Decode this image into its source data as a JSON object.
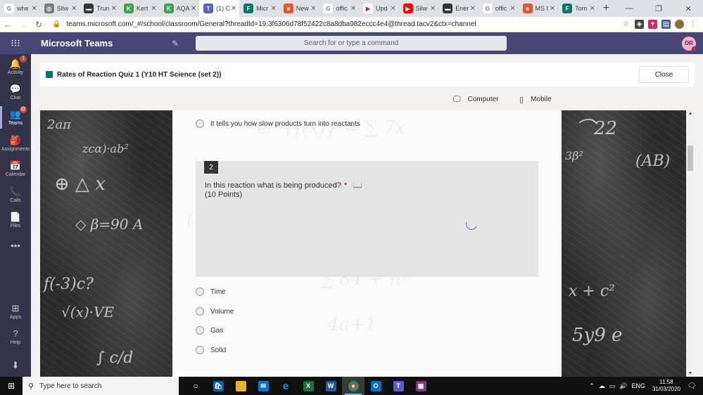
{
  "browser": {
    "tabs": [
      {
        "title": "whe",
        "favicon_letter": "G",
        "color": "#ffffff",
        "fg": "#4285f4",
        "active": false
      },
      {
        "title": "Silw",
        "favicon_letter": "◎",
        "color": "#7a7a7a",
        "fg": "#ffffff",
        "active": false
      },
      {
        "title": "Trun",
        "favicon_letter": "▬",
        "color": "#333333",
        "fg": "#ffffff",
        "active": false
      },
      {
        "title": "Kert",
        "favicon_letter": "K",
        "color": "#3aa655",
        "fg": "#ffffff",
        "active": false
      },
      {
        "title": "AQA",
        "favicon_letter": "K",
        "color": "#3aa655",
        "fg": "#ffffff",
        "active": false
      },
      {
        "title": "(1) C",
        "favicon_letter": "T",
        "color": "#5b5fc7",
        "fg": "#ffffff",
        "active": true
      },
      {
        "title": "Micr",
        "favicon_letter": "F",
        "color": "#077568",
        "fg": "#ffffff",
        "active": false
      },
      {
        "title": "New",
        "favicon_letter": "■",
        "color": "#f25022",
        "fg": "#ffffff",
        "active": false
      },
      {
        "title": "offic",
        "favicon_letter": "G",
        "color": "#ffffff",
        "fg": "#4285f4",
        "active": false
      },
      {
        "title": "Upd",
        "favicon_letter": "▶",
        "color": "#ffffff",
        "fg": "#c2185b",
        "active": false
      },
      {
        "title": "Silw",
        "favicon_letter": "▶",
        "color": "#ff0000",
        "fg": "#ffffff",
        "active": false
      },
      {
        "title": "Ener",
        "favicon_letter": "▬",
        "color": "#333333",
        "fg": "#ffffff",
        "active": false
      },
      {
        "title": "offic",
        "favicon_letter": "G",
        "color": "#ffffff",
        "fg": "#4285f4",
        "active": false
      },
      {
        "title": "MS I",
        "favicon_letter": "■",
        "color": "#f25022",
        "fg": "#ffffff",
        "active": false
      },
      {
        "title": "Tom",
        "favicon_letter": "F",
        "color": "#077568",
        "fg": "#ffffff",
        "active": false
      }
    ],
    "tab_close": "✕",
    "new_tab": "+",
    "url": "teams.microsoft.com/_#/school/classroom/General?threadId=19:3f6306d78f52422c8a8dba982eccc4e4@thread.tacv2&ctx=channel"
  },
  "teams": {
    "app_name": "Microsoft Teams",
    "search_placeholder": "Search for or type a command",
    "avatar_initials": "DR",
    "rail": [
      {
        "label": "Activity",
        "icon": "bell-icon",
        "glyph": "🔔",
        "badge": "1"
      },
      {
        "label": "Chat",
        "icon": "chat-icon",
        "glyph": "💬",
        "badge": ""
      },
      {
        "label": "Teams",
        "icon": "teams-icon",
        "glyph": "👥",
        "badge": "@"
      },
      {
        "label": "Assignments",
        "icon": "assignments-icon",
        "glyph": "🎒",
        "badge": ""
      },
      {
        "label": "Calendar",
        "icon": "calendar-icon",
        "glyph": "📅",
        "badge": ""
      },
      {
        "label": "Calls",
        "icon": "phone-icon",
        "glyph": "📞",
        "badge": ""
      },
      {
        "label": "Files",
        "icon": "file-icon",
        "glyph": "📄",
        "badge": ""
      },
      {
        "label": "",
        "icon": "more-icon",
        "glyph": "•••",
        "badge": ""
      },
      {
        "label": "Apps",
        "icon": "apps-icon",
        "glyph": "⊞",
        "badge": ""
      },
      {
        "label": "Help",
        "icon": "help-icon",
        "glyph": "?",
        "badge": ""
      },
      {
        "label": "",
        "icon": "download-icon",
        "glyph": "⬇",
        "badge": ""
      }
    ],
    "tab_title": "Rates of Reaction Quiz 1 (Y10 HT Science (set 2))",
    "close_label": "Close",
    "devices": {
      "computer": "Computer",
      "mobile": "Mobile"
    }
  },
  "form": {
    "prev_option": "It tells you how slow products turn into reactants",
    "question_number": "2",
    "question_text": "In this reaction what is being produced?",
    "required_mark": "*",
    "points": "(10 Points)",
    "options": [
      "Time",
      "Volume",
      "Gas",
      "Solid"
    ]
  },
  "taskbar": {
    "search_placeholder": "Type here to search",
    "language": "ENG",
    "time": "11:58",
    "date": "31/03/2020"
  }
}
